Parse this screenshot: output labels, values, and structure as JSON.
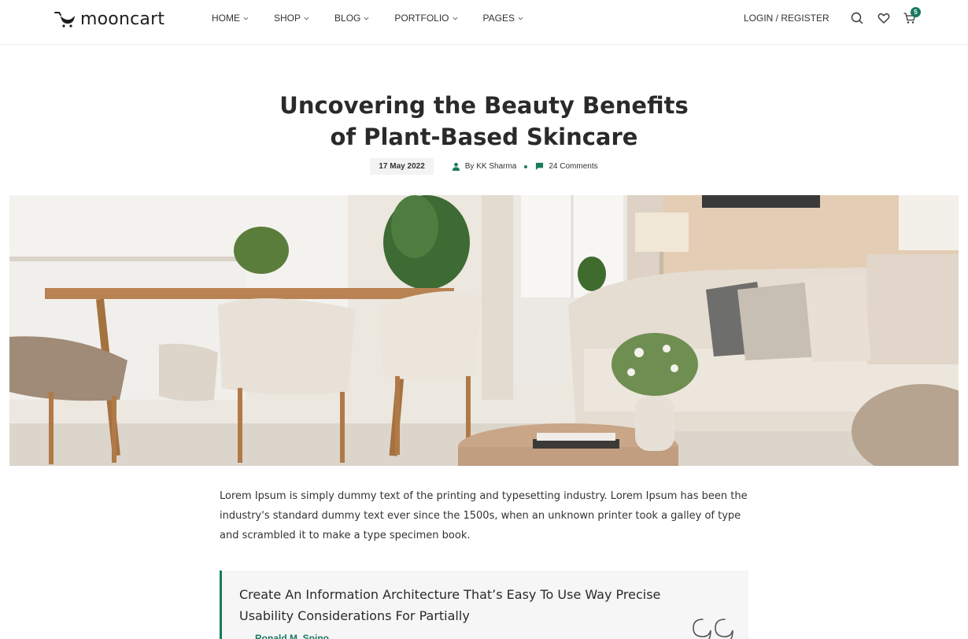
{
  "header": {
    "logo_text": "mooncart",
    "nav": [
      {
        "label": "HOME"
      },
      {
        "label": "SHOP"
      },
      {
        "label": "BLOG"
      },
      {
        "label": "PORTFOLIO"
      },
      {
        "label": "PAGES"
      }
    ],
    "login_label": "LOGIN / REGISTER",
    "cart_count": "5",
    "icons": [
      "search-icon",
      "heart-icon",
      "cart-icon"
    ]
  },
  "article": {
    "title_line1": "Uncovering the Beauty Benefits",
    "title_line2": "of Plant-Based Skincare",
    "date": "17 May 2022",
    "author": "By KK Sharma",
    "comments": "24 Comments",
    "paragraph": "Lorem Ipsum is simply dummy text of the printing and typesetting industry. Lorem Ipsum has been the industry's standard dummy text ever since the 1500s, when an unknown printer took a galley of type and scrambled it to make a type specimen book.",
    "quote_text": "Create An Information Architecture That’s Easy To Use Way Precise Usability Considerations For Partially",
    "quote_author": "Ronald M. Spino"
  },
  "colors": {
    "accent": "#1a7a5e",
    "text": "#2a2a2a"
  }
}
